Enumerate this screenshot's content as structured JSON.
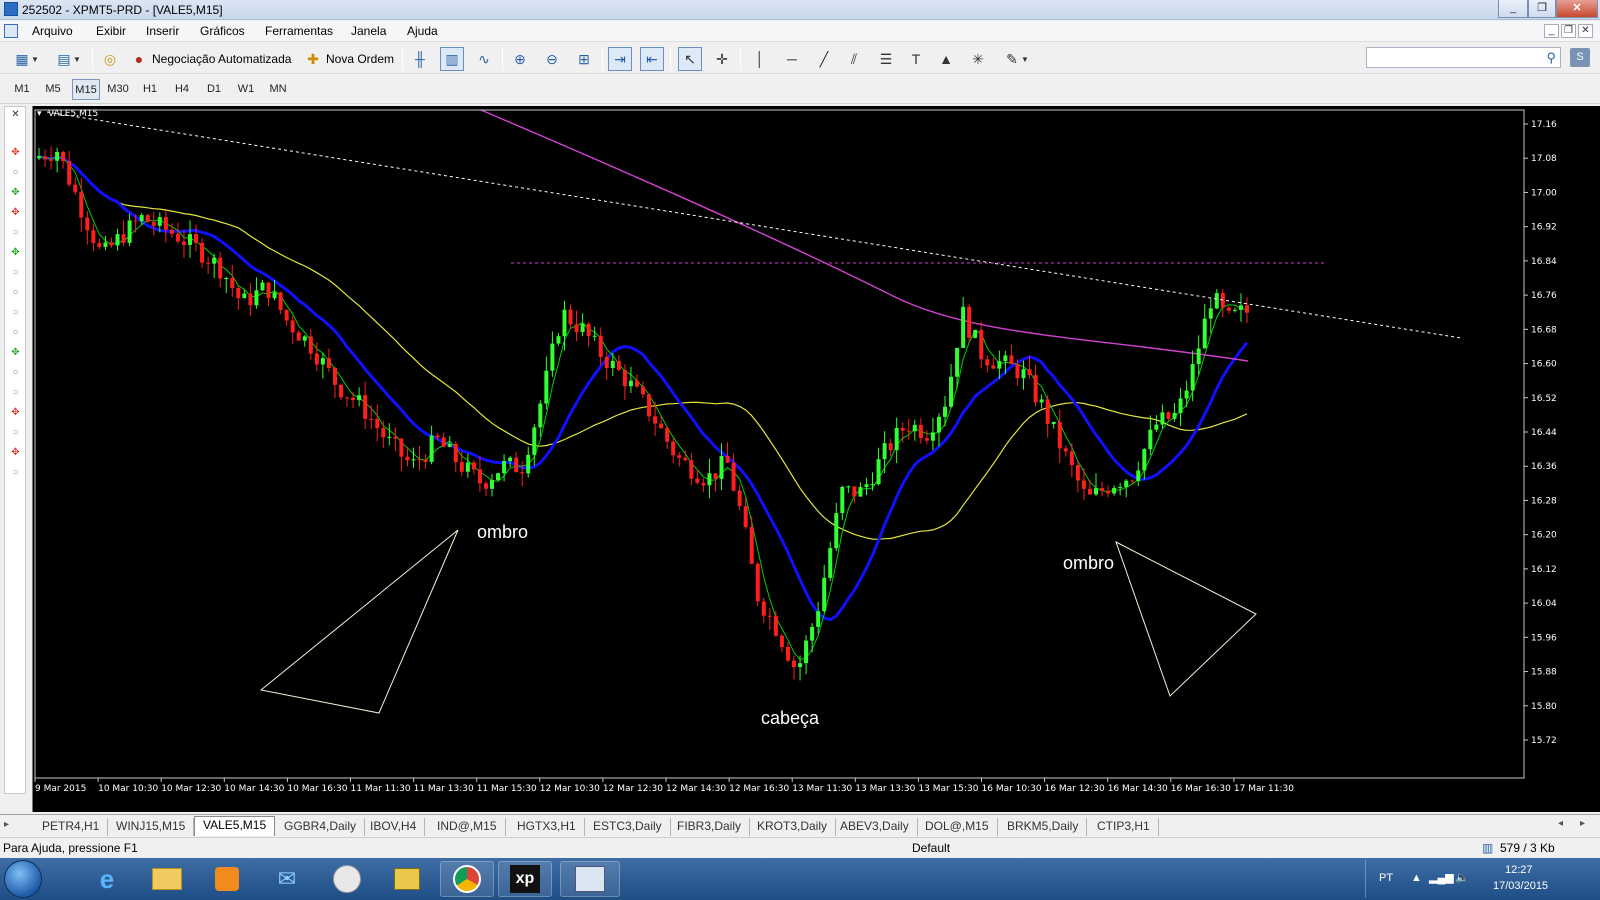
{
  "window": {
    "title": "252502 - XPMT5-PRD - [VALE5,M15]",
    "controls": [
      "_",
      "❐",
      "✕"
    ]
  },
  "menu": {
    "items": [
      "Arquivo",
      "Exibir",
      "Inserir",
      "Gráficos",
      "Ferramentas",
      "Janela",
      "Ajuda"
    ],
    "mdi_controls": [
      "_",
      "❐",
      "✕"
    ]
  },
  "toolbar": {
    "auto_trading_label": "Negociação Automatizada",
    "new_order_label": "Nova Ordem",
    "search_placeholder": "",
    "help_label": "S"
  },
  "timeframes": {
    "items": [
      "M1",
      "M5",
      "M15",
      "M30",
      "H1",
      "H4",
      "D1",
      "W1",
      "MN"
    ],
    "active": "M15"
  },
  "chart": {
    "symbol_label": "VALE5,M15",
    "annotations": {
      "left_shoulder": "ombro",
      "head": "cabeça",
      "right_shoulder": "ombro"
    },
    "price_ticks": [
      "17.16",
      "17.08",
      "17.00",
      "16.92",
      "16.84",
      "16.76",
      "16.68",
      "16.60",
      "16.52",
      "16.44",
      "16.36",
      "16.28",
      "16.20",
      "16.12",
      "16.04",
      "15.96",
      "15.88",
      "15.80",
      "15.72"
    ],
    "time_ticks": [
      "9 Mar 2015",
      "10 Mar 10:30",
      "10 Mar 12:30",
      "10 Mar 14:30",
      "10 Mar 16:30",
      "11 Mar 11:30",
      "11 Mar 13:30",
      "11 Mar 15:30",
      "12 Mar 10:30",
      "12 Mar 12:30",
      "12 Mar 14:30",
      "12 Mar 16:30",
      "13 Mar 11:30",
      "13 Mar 13:30",
      "13 Mar 15:30",
      "16 Mar 10:30",
      "16 Mar 12:30",
      "16 Mar 14:30",
      "16 Mar 16:30",
      "17 Mar 11:30"
    ],
    "colors": {
      "background": "#000000",
      "bull": "#32ff32",
      "bear": "#ff1e1e",
      "ma_fast": "#00d000",
      "ma_mid": "#1010ff",
      "ma_slow": "#e5e53a",
      "ma_long": "#d040d0",
      "trendline": "#ffffff",
      "resistance": "#d040d0"
    }
  },
  "tabs": {
    "items": [
      "PETR4,H1",
      "WINJ15,M15",
      "VALE5,M15",
      "GGBR4,Daily",
      "IBOV,H4",
      "IND@,M15",
      "HGTX3,H1",
      "ESTC3,Daily",
      "FIBR3,Daily",
      "KROT3,Daily",
      "ABEV3,Daily",
      "DOL@,M15",
      "BRKM5,Daily",
      "CTIP3,H1"
    ],
    "active": "VALE5,M15"
  },
  "status": {
    "help": "Para Ajuda, pressione F1",
    "profile": "Default",
    "traffic": "579 / 3 Kb"
  },
  "taskbar": {
    "language": "PT",
    "time": "12:27",
    "date": "17/03/2015",
    "xp_label": "xp"
  }
}
